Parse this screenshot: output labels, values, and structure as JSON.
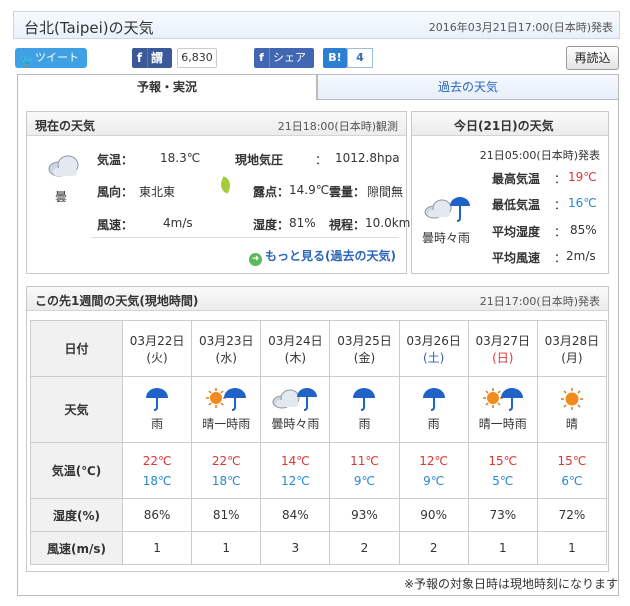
{
  "header": {
    "title": "台北(Taipei)の天気",
    "issued": "2016年03月21日17:00(日本時)発表"
  },
  "social": {
    "tweet_label": "ツイート",
    "fb_like_label": "謂",
    "fb_count": "6,830",
    "share_label": "シェア",
    "hatena_label": "B!",
    "hatena_count": "4"
  },
  "reload_label": "再読込",
  "tabs": {
    "forecast": "予報・実況",
    "past": "過去の天気"
  },
  "current": {
    "heading": "現在の天気",
    "observed": "21日18:00(日本時)観測",
    "icon": "cloud-icon",
    "condition": "曇",
    "temp_label": "気温：",
    "temp": "18.3℃",
    "pressure_label": "現地気圧",
    "pressure_sep": "：",
    "pressure": "1012.8hpa",
    "wind_dir_label": "風向：",
    "wind_dir": "東北東",
    "dew_label": "露点：",
    "dew": "14.9℃",
    "cloud_label": "雲量：",
    "cloud": "隙間無",
    "wind_speed_label": "風速：",
    "wind_speed": "4m/s",
    "humidity_label": "湿度：",
    "humidity": "81%",
    "visibility_label": "視程：",
    "visibility": "10.0km",
    "more_link": "もっと見る(過去の天気)"
  },
  "today": {
    "heading": "今日(21日)の天気",
    "issued": "21日05:00(日本時)発表",
    "icon": "cloud-umbrella-icon",
    "condition": "曇時々雨",
    "max_label": "最高気温",
    "max_sep": "：",
    "max": "19℃",
    "min_label": "最低気温",
    "min_sep": "：",
    "min": "16℃",
    "hum_label": "平均湿度",
    "hum_sep": "：",
    "hum": "85%",
    "wind_label": "平均風速",
    "wind_sep": "：",
    "wind": "2m/s"
  },
  "week": {
    "heading": "この先1週間の天気(現地時間)",
    "issued": "21日17:00(日本時)発表",
    "row_labels": {
      "date": "日付",
      "weather": "天気",
      "temp": "気温(℃)",
      "humidity": "湿度(%)",
      "wind": "風速(m/s)"
    },
    "days": [
      {
        "date": "03月22日",
        "dow": "(火)",
        "weather": "雨",
        "icon": "umbrella-icon",
        "max": "22℃",
        "min": "18℃",
        "humidity": "86%",
        "wind": "1"
      },
      {
        "date": "03月23日",
        "dow": "(水)",
        "weather": "晴一時雨",
        "icon": "sun-umbrella-icon",
        "max": "22℃",
        "min": "18℃",
        "humidity": "81%",
        "wind": "1"
      },
      {
        "date": "03月24日",
        "dow": "(木)",
        "weather": "曇時々雨",
        "icon": "cloud-umbrella-icon",
        "max": "14℃",
        "min": "12℃",
        "humidity": "84%",
        "wind": "3"
      },
      {
        "date": "03月25日",
        "dow": "(金)",
        "weather": "雨",
        "icon": "umbrella-icon",
        "max": "11℃",
        "min": "9℃",
        "humidity": "93%",
        "wind": "2"
      },
      {
        "date": "03月26日",
        "dow": "(土)",
        "weather": "雨",
        "icon": "umbrella-icon",
        "max": "12℃",
        "min": "9℃",
        "humidity": "90%",
        "wind": "2"
      },
      {
        "date": "03月27日",
        "dow": "(日)",
        "weather": "晴一時雨",
        "icon": "sun-umbrella-icon",
        "max": "15℃",
        "min": "5℃",
        "humidity": "73%",
        "wind": "1"
      },
      {
        "date": "03月28日",
        "dow": "(月)",
        "weather": "晴",
        "icon": "sun-icon",
        "max": "15℃",
        "min": "6℃",
        "humidity": "72%",
        "wind": "1"
      }
    ]
  },
  "footnote": "※予報の対象日時は現地時刻になります",
  "colors": {
    "max_temp": "#e03434",
    "min_temp": "#2a86d8",
    "link": "#2a66b8"
  }
}
